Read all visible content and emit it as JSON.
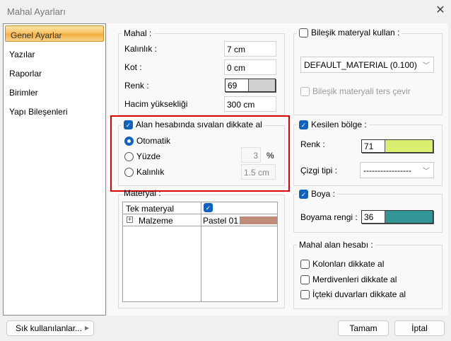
{
  "window": {
    "title": "Mahal Ayarları"
  },
  "sidebar": {
    "items": [
      {
        "label": "Genel Ayarlar"
      },
      {
        "label": "Yazılar"
      },
      {
        "label": "Raporlar"
      },
      {
        "label": "Birimler"
      },
      {
        "label": "Yapı Bileşenleri"
      }
    ]
  },
  "mahal": {
    "legend": "Mahal :",
    "kalinlik_label": "Kalınlık :",
    "kalinlik": "7 cm",
    "kot_label": "Kot :",
    "kot": "0 cm",
    "renk_label": "Renk :",
    "renk": "69",
    "renk_color": "#d0d0d0",
    "hacim_label": "Hacim yüksekliği",
    "hacim": "300 cm"
  },
  "siva": {
    "label": "Alan hesabında sıvalan dikkate al",
    "checked": true,
    "otomatik": "Otomatik",
    "yuzde": "Yüzde",
    "yuzde_value": "3",
    "percent": "%",
    "kalinlik": "Kalınlık",
    "kalinlik_value": "1.5 cm"
  },
  "materyal": {
    "legend": "Materyal :",
    "rows": [
      {
        "name": "Tek materyal",
        "value_checked": true
      },
      {
        "name": "Malzeme",
        "value": "Pastel 01",
        "color": "#c08c78"
      }
    ]
  },
  "bilesik": {
    "label": "Bileşik materyal kullan :",
    "checked": false,
    "material": "DEFAULT_MATERIAL (0.100)",
    "ters": "Bileşik materyali ters çevir"
  },
  "kesilen": {
    "label": "Kesilen bölge :",
    "checked": true,
    "renk_label": "Renk :",
    "renk": "71",
    "renk_color": "#dcee70",
    "cizgi_label": "Çizgi tipi :",
    "cizgi": "-----------------"
  },
  "boya": {
    "label": "Boya :",
    "checked": true,
    "renk_label": "Boyama rengi :",
    "renk": "36",
    "renk_color": "#329696"
  },
  "alan": {
    "legend": "Mahal alan hesabı :",
    "items": [
      {
        "label": "Kolonları dikkate al"
      },
      {
        "label": "Merdivenleri dikkate al"
      },
      {
        "label": "İçteki duvarları dikkate al"
      }
    ]
  },
  "footer": {
    "favorites": "Sık kullanılanlar...",
    "ok": "Tamam",
    "cancel": "İptal"
  }
}
